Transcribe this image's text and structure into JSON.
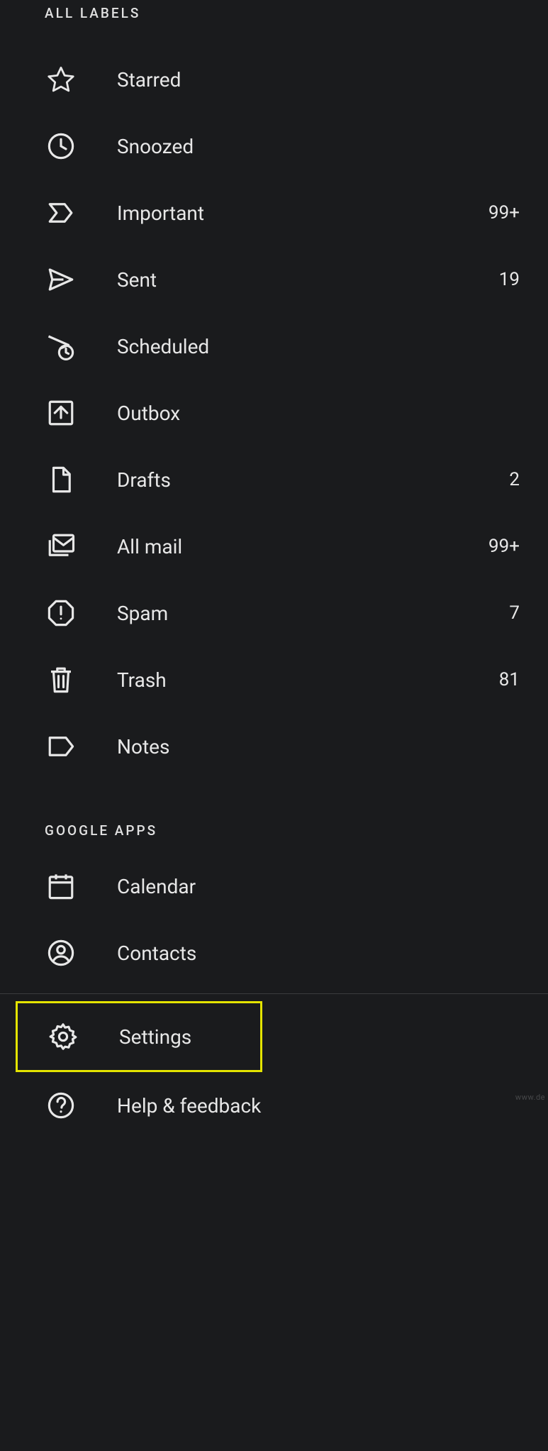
{
  "sections": {
    "labels_header": "ALL LABELS",
    "google_header": "GOOGLE APPS"
  },
  "labels": [
    {
      "icon": "star",
      "label": "Starred",
      "count": ""
    },
    {
      "icon": "snoozed",
      "label": "Snoozed",
      "count": ""
    },
    {
      "icon": "important",
      "label": "Important",
      "count": "99+"
    },
    {
      "icon": "sent",
      "label": "Sent",
      "count": "19"
    },
    {
      "icon": "scheduled",
      "label": "Scheduled",
      "count": ""
    },
    {
      "icon": "outbox",
      "label": "Outbox",
      "count": ""
    },
    {
      "icon": "drafts",
      "label": "Drafts",
      "count": "2"
    },
    {
      "icon": "allmail",
      "label": "All mail",
      "count": "99+"
    },
    {
      "icon": "spam",
      "label": "Spam",
      "count": "7"
    },
    {
      "icon": "trash",
      "label": "Trash",
      "count": "81"
    },
    {
      "icon": "notes",
      "label": "Notes",
      "count": ""
    }
  ],
  "google_apps": [
    {
      "icon": "calendar",
      "label": "Calendar"
    },
    {
      "icon": "contacts",
      "label": "Contacts"
    }
  ],
  "bottom": [
    {
      "icon": "settings",
      "label": "Settings",
      "highlight": true
    },
    {
      "icon": "help",
      "label": "Help & feedback"
    }
  ],
  "watermark": "www.de"
}
